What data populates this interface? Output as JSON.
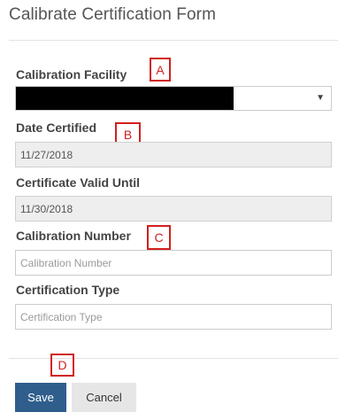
{
  "form": {
    "title": "Calibrate Certification Form",
    "calibration_facility": {
      "label": "Calibration Facility",
      "value": "",
      "redacted": true,
      "dropdown_icon": "caret-down-icon"
    },
    "date_certified": {
      "label": "Date Certified",
      "value": "11/27/2018"
    },
    "certificate_valid_until": {
      "label": "Certificate Valid Until",
      "value": "11/30/2018"
    },
    "calibration_number": {
      "label": "Calibration Number",
      "value": "",
      "placeholder": "Calibration Number"
    },
    "certification_type": {
      "label": "Certification Type",
      "value": "",
      "placeholder": "Certification Type"
    }
  },
  "buttons": {
    "save_label": "Save",
    "cancel_label": "Cancel"
  },
  "annotations": [
    {
      "label": "A"
    },
    {
      "label": "B"
    },
    {
      "label": "C"
    },
    {
      "label": "D"
    }
  ],
  "colors": {
    "primary_button": "#2f5e8c",
    "secondary_button": "#e6e6e6",
    "annotation": "#d21f1f",
    "readonly_field": "#eeeeee"
  }
}
